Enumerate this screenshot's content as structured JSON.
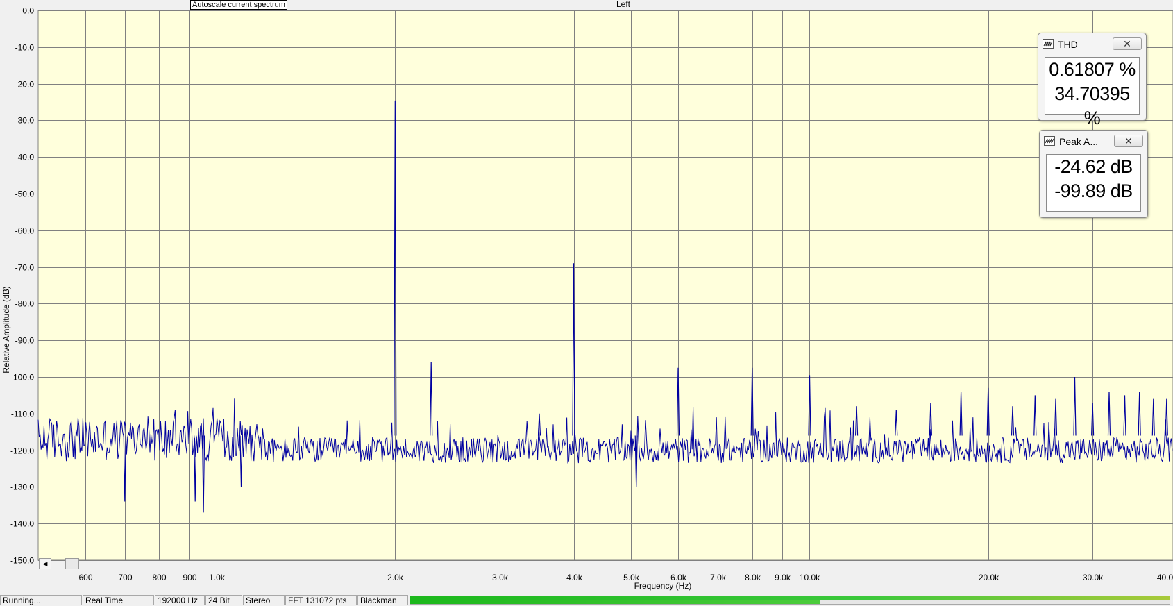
{
  "window": {
    "autoscale_label": "Autoscale current spectrum",
    "status": {
      "state": "Running...",
      "mode": "Real Time",
      "sample_rate": "192000 Hz",
      "bit_depth": "24 Bit",
      "channels": "Stereo",
      "fft_size": "FFT 131072 pts",
      "window_fn": "Blackman"
    },
    "level_meter": {
      "top": 1.0,
      "bottom": 0.54
    }
  },
  "meters": {
    "thd": {
      "title": "THD",
      "value1": "0.61807 %",
      "value2": "34.70395 %"
    },
    "peak": {
      "title": "Peak A...",
      "value1": "-24.62 dB",
      "value2": "-99.89 dB"
    }
  },
  "chart_data": {
    "type": "line",
    "title": "Left",
    "xlabel": "Frequency (Hz)",
    "ylabel": "Relative Amplitude (dB)",
    "x_scale": "log",
    "xlim": [
      500,
      41000
    ],
    "ylim": [
      -150,
      0
    ],
    "grid": true,
    "background_color": "#ffffdc",
    "line_color": "#0000a0",
    "grid_color": "#808080",
    "yticks": [
      "0.0",
      "-10.0",
      "-20.0",
      "-30.0",
      "-40.0",
      "-50.0",
      "-60.0",
      "-70.0",
      "-80.0",
      "-90.0",
      "-100.0",
      "-110.0",
      "-120.0",
      "-130.0",
      "-140.0",
      "-150.0"
    ],
    "ytick_values": [
      0,
      -10,
      -20,
      -30,
      -40,
      -50,
      -60,
      -70,
      -80,
      -90,
      -100,
      -110,
      -120,
      -130,
      -140,
      -150
    ],
    "xticks": [
      "600",
      "700",
      "800",
      "900",
      "1.0k",
      "2.0k",
      "3.0k",
      "4.0k",
      "5.0k",
      "6.0k",
      "7.0k",
      "8.0k",
      "9.0k",
      "10.0k",
      "20.0k",
      "30.0k",
      "40.0k"
    ],
    "xtick_values": [
      600,
      700,
      800,
      900,
      1000,
      2000,
      3000,
      4000,
      5000,
      6000,
      7000,
      8000,
      9000,
      10000,
      20000,
      30000,
      40000
    ],
    "noise_floor_db": -120,
    "peaks": [
      {
        "x": 2000,
        "y": -24.6
      },
      {
        "x": 2300,
        "y": -96
      },
      {
        "x": 3500,
        "y": -110
      },
      {
        "x": 4000,
        "y": -69
      },
      {
        "x": 6000,
        "y": -97.5
      },
      {
        "x": 8000,
        "y": -97.5
      },
      {
        "x": 10000,
        "y": -99.5
      },
      {
        "x": 12000,
        "y": -108
      },
      {
        "x": 14000,
        "y": -109
      },
      {
        "x": 16000,
        "y": -107
      },
      {
        "x": 18000,
        "y": -104
      },
      {
        "x": 20000,
        "y": -103
      },
      {
        "x": 22000,
        "y": -108
      },
      {
        "x": 24000,
        "y": -105
      },
      {
        "x": 26000,
        "y": -106
      },
      {
        "x": 28000,
        "y": -100
      },
      {
        "x": 30000,
        "y": -107
      },
      {
        "x": 32000,
        "y": -104
      },
      {
        "x": 34000,
        "y": -105
      },
      {
        "x": 36000,
        "y": -104
      },
      {
        "x": 38000,
        "y": -106
      },
      {
        "x": 40000,
        "y": -106
      }
    ],
    "dips": [
      {
        "x": 700,
        "y": -134
      },
      {
        "x": 920,
        "y": -134
      },
      {
        "x": 950,
        "y": -137
      },
      {
        "x": 1100,
        "y": -130
      },
      {
        "x": 5100,
        "y": -130
      }
    ]
  }
}
